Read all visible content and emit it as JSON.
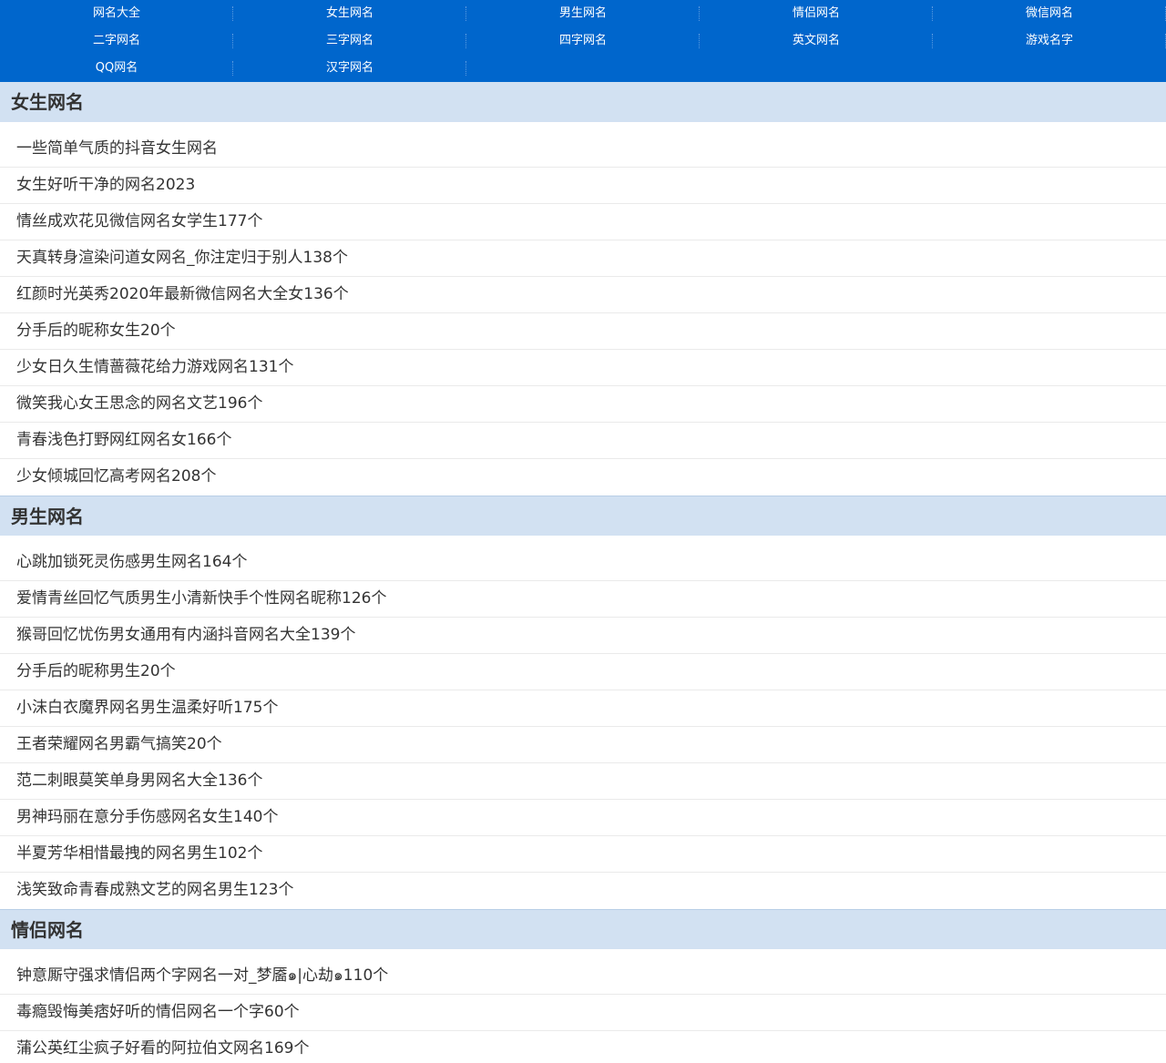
{
  "nav": {
    "rows": [
      [
        "网名大全",
        "女生网名",
        "男生网名",
        "情侣网名",
        "微信网名"
      ],
      [
        "二字网名",
        "三字网名",
        "四字网名",
        "英文网名",
        "游戏名字"
      ],
      [
        "QQ网名",
        "汉字网名"
      ]
    ]
  },
  "sections": [
    {
      "title": "女生网名",
      "items": [
        "一些简单气质的抖音女生网名",
        "女生好听干净的网名2023",
        "情丝成欢花见微信网名女学生177个",
        "天真转身渲染问道女网名_你注定归于别人138个",
        "红颜时光英秀2020年最新微信网名大全女136个",
        "分手后的昵称女生20个",
        "少女日久生情蔷薇花给力游戏网名131个",
        "微笑我心女王思念的网名文艺196个",
        "青春浅色打野网红网名女166个",
        "少女倾城回忆高考网名208个"
      ]
    },
    {
      "title": "男生网名",
      "items": [
        "心跳加锁死灵伤感男生网名164个",
        "爱情青丝回忆气质男生小清新快手个性网名昵称126个",
        "猴哥回忆忧伤男女通用有内涵抖音网名大全139个",
        "分手后的昵称男生20个",
        "小沫白衣魔界网名男生温柔好听175个",
        "王者荣耀网名男霸气搞笑20个",
        "范二刺眼莫笑单身男网名大全136个",
        "男神玛丽在意分手伤感网名女生140个",
        "半夏芳华相惜最拽的网名男生102个",
        "浅笑致命青春成熟文艺的网名男生123个"
      ]
    },
    {
      "title": "情侣网名",
      "items": [
        "钟意厮守强求情侣两个字网名一对_梦靥๑|心劫๑110个",
        "毒瘾毁悔美痞好听的情侣网名一个字60个",
        "蒲公英红尘疯子好看的阿拉伯文网名169个"
      ]
    }
  ]
}
